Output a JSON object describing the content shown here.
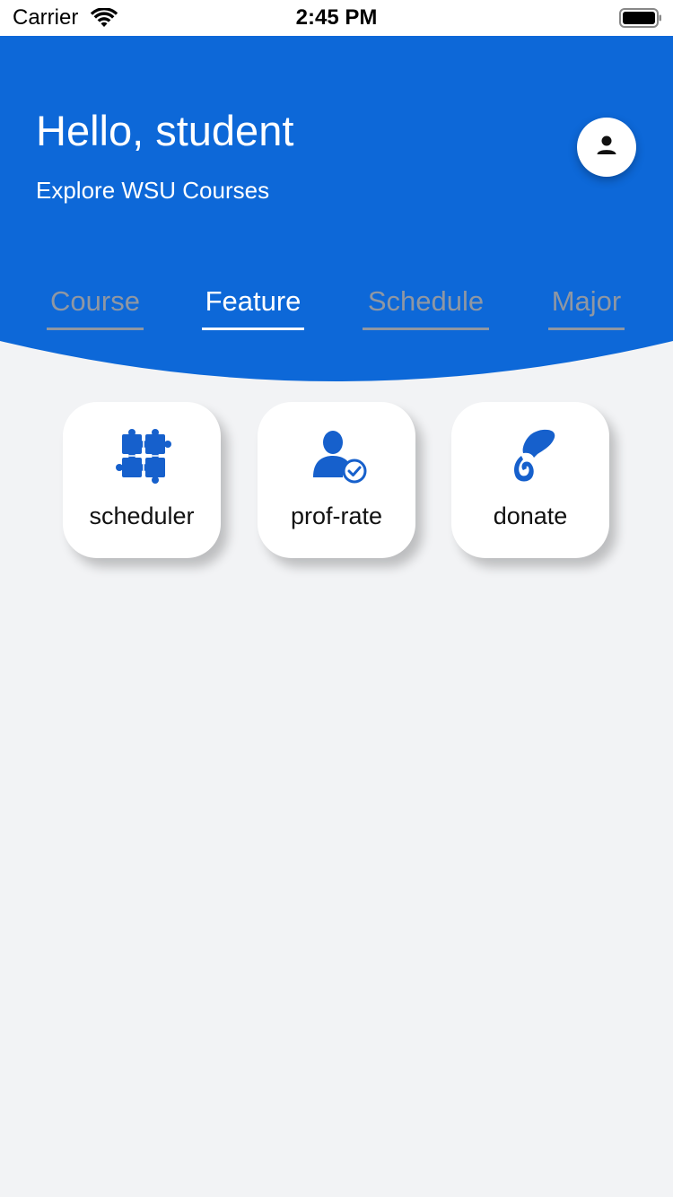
{
  "status_bar": {
    "carrier": "Carrier",
    "time": "2:45 PM",
    "wifi_icon": "wifi-icon",
    "battery_icon": "battery-icon"
  },
  "header": {
    "greeting": "Hello, student",
    "subtitle": "Explore WSU Courses",
    "profile_icon": "person-icon",
    "background_color": "#0d68d8"
  },
  "tabs": [
    {
      "label": "Course",
      "active": false
    },
    {
      "label": "Feature",
      "active": true
    },
    {
      "label": "Schedule",
      "active": false
    },
    {
      "label": "Major",
      "active": false
    }
  ],
  "features": [
    {
      "label": "scheduler",
      "icon": "puzzle-icon"
    },
    {
      "label": "prof-rate",
      "icon": "person-check-icon"
    },
    {
      "label": "donate",
      "icon": "donate-hand-icon"
    }
  ],
  "colors": {
    "brand_blue": "#0d68d8",
    "inactive_tab": "#8f97a3",
    "page_background": "#f2f3f5"
  }
}
